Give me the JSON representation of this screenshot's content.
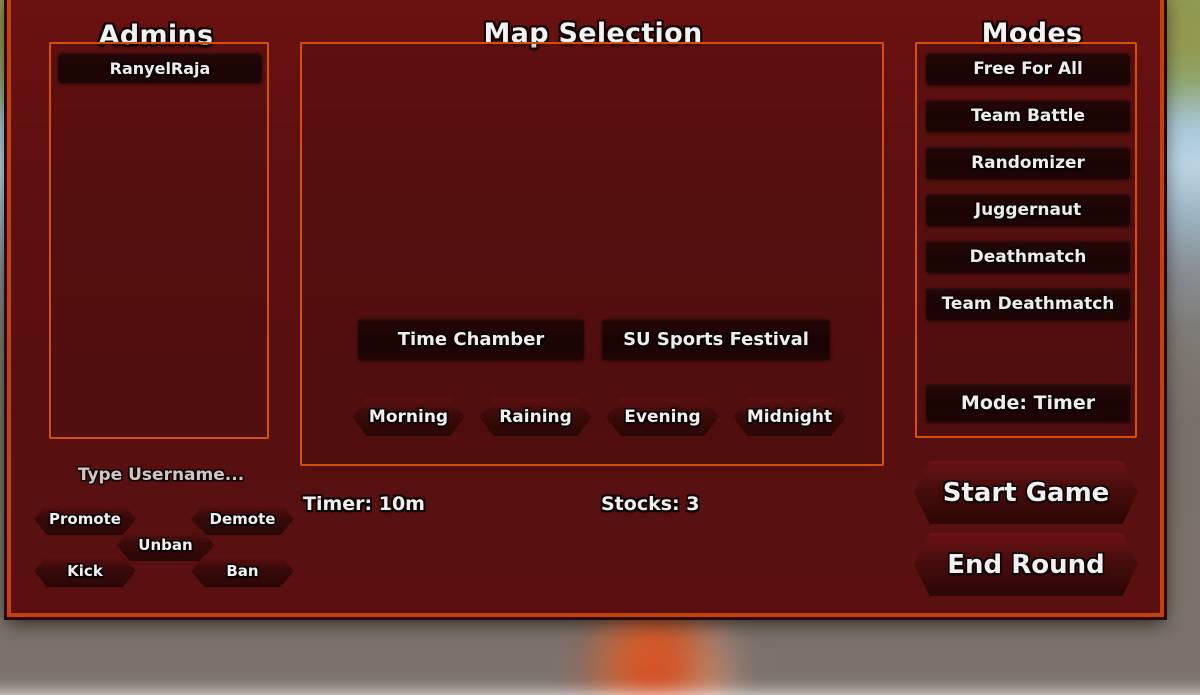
{
  "background": {
    "scene": "blurred-game-world"
  },
  "admins_panel": {
    "title": "Admins",
    "list": [
      {
        "name": "RanyelRaja"
      }
    ],
    "username_input": {
      "value": "",
      "placeholder": "Type Username..."
    },
    "actions": [
      {
        "label": "Promote"
      },
      {
        "label": "Demote"
      },
      {
        "label": "Unban"
      },
      {
        "label": "Kick"
      },
      {
        "label": "Ban"
      }
    ]
  },
  "map_panel": {
    "title": "Map Selection",
    "maps": [
      {
        "label": "Time Chamber"
      },
      {
        "label": "SU Sports Festival"
      }
    ],
    "times_of_day": [
      {
        "label": "Morning"
      },
      {
        "label": "Raining"
      },
      {
        "label": "Evening"
      },
      {
        "label": "Midnight"
      }
    ],
    "stats": {
      "timer": "Timer: 10m",
      "stocks": "Stocks: 3"
    }
  },
  "modes_panel": {
    "title": "Modes",
    "modes": [
      {
        "label": "Free For All"
      },
      {
        "label": "Team Battle"
      },
      {
        "label": "Randomizer"
      },
      {
        "label": "Juggernaut"
      },
      {
        "label": "Deathmatch"
      },
      {
        "label": "Team Deathmatch"
      }
    ],
    "mode_toggle": {
      "label": "Mode: Timer"
    },
    "start_button": {
      "label": "Start Game"
    },
    "end_button": {
      "label": "End Round"
    }
  },
  "colors": {
    "panel_border": "#d4500f",
    "dialog_border": "#c2410c",
    "dialog_bg": "#5d1010",
    "item_bg": "#1a0404",
    "text": "#f2f2f2"
  }
}
